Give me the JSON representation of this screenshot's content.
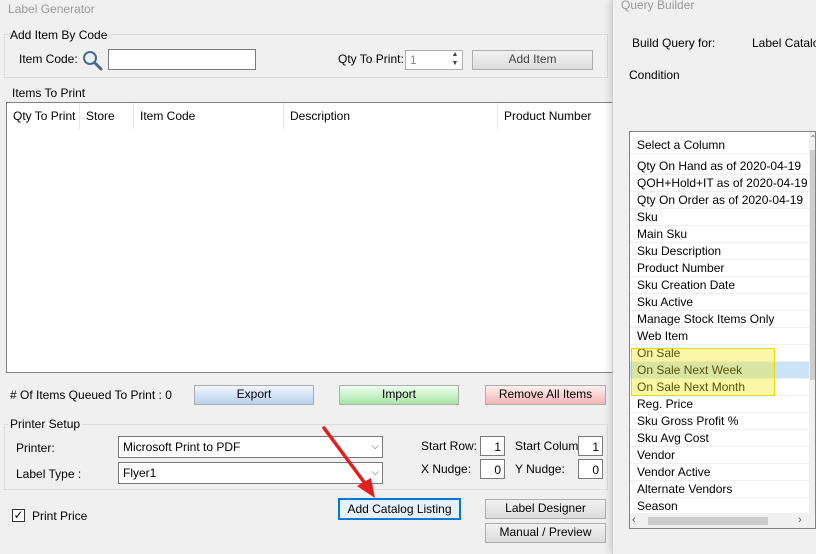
{
  "main": {
    "title": "Label Generator",
    "add_by_code": {
      "group_label": "Add Item By Code",
      "item_code_label": "Item Code:",
      "item_code_value": "",
      "qty_label": "Qty To Print:",
      "qty_value": "1",
      "add_button": "Add Item"
    },
    "items": {
      "group_label": "Items To Print",
      "columns": [
        "Qty To Print",
        "Store",
        "Item Code",
        "Description",
        "Product Number"
      ],
      "queued_label": "# Of Items Queued To Print :",
      "queued_count": "0",
      "export_button": "Export",
      "import_button": "Import",
      "remove_all_button": "Remove All Items"
    },
    "printer": {
      "group_label": "Printer Setup",
      "printer_label": "Printer:",
      "printer_value": "Microsoft Print to PDF",
      "label_type_label": "Label Type :",
      "label_type_value": "Flyer1",
      "start_row_label": "Start Row:",
      "start_row_value": "1",
      "start_col_label": "Start Column:",
      "start_col_value": "1",
      "x_nudge_label": "X Nudge:",
      "x_nudge_value": "0",
      "y_nudge_label": "Y Nudge:",
      "y_nudge_value": "0"
    },
    "print_price_label": "Print Price",
    "print_price_checked": true,
    "add_catalog_button": "Add Catalog Listing",
    "label_designer_button": "Label Designer",
    "manual_preview_button": "Manual / Preview"
  },
  "query": {
    "title": "Query Builder",
    "build_for_label": "Build Query for:",
    "build_for_value": "Label Catalog",
    "condition_label": "Condition",
    "columns": [
      "Select a Column",
      "Qty On Hand as of 2020-04-19",
      "QOH+Hold+IT as of 2020-04-19",
      "Qty On Order as of 2020-04-19",
      "Sku",
      "Main Sku",
      "Sku Description",
      "Product Number",
      "Sku Creation Date",
      "Sku Active",
      "Manage Stock Items Only",
      "Web Item",
      "On Sale",
      "On Sale Next Week",
      "On Sale Next Month",
      "Reg. Price",
      "Sku Gross Profit %",
      "Sku Avg Cost",
      "Vendor",
      "Vendor Active",
      "Alternate Vendors",
      "Season"
    ],
    "highlight_color": "#f4f000",
    "selected_color": "#cce4f7"
  }
}
